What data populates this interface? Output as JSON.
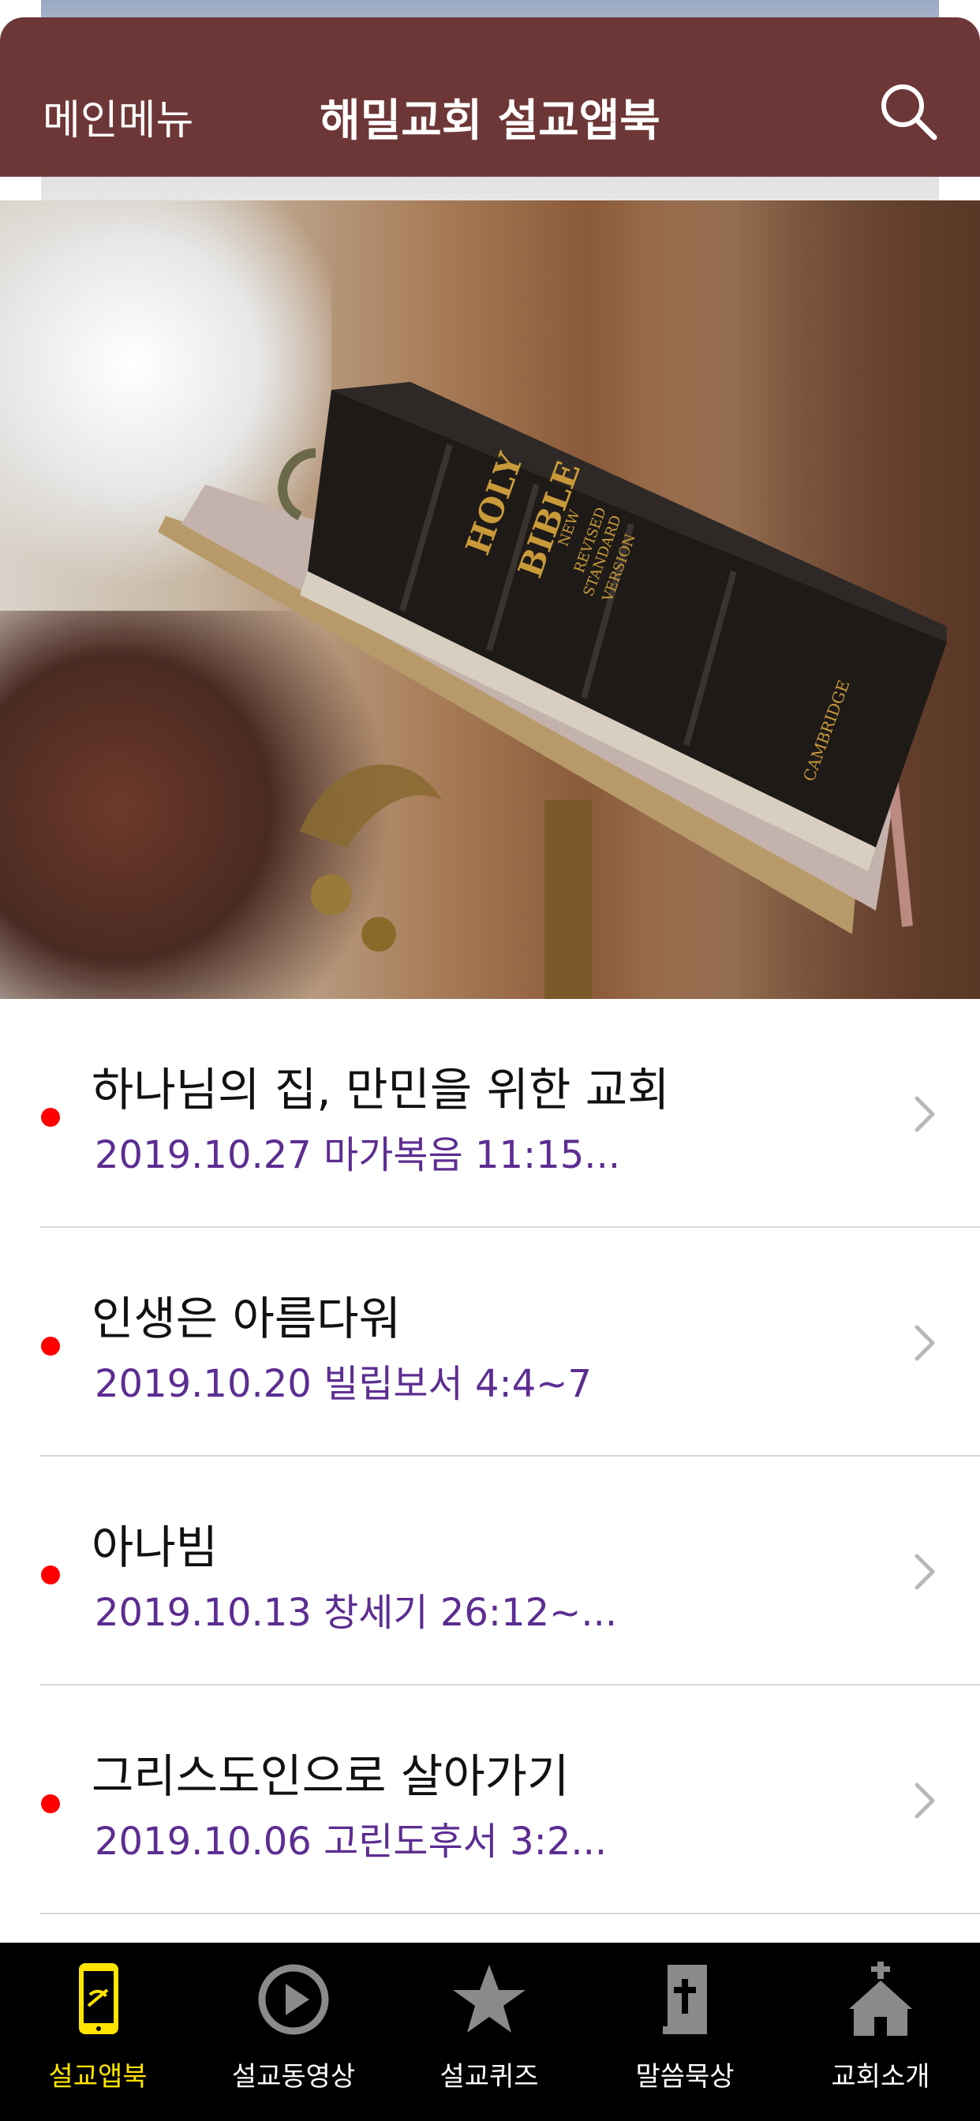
{
  "header": {
    "menu_label": "메인메뉴",
    "title": "해밀교회 설교앱북",
    "search_icon": "search-icon",
    "background": "#6e3737"
  },
  "hero": {
    "image": "bible-on-lectern",
    "book_text": {
      "title_line1": "HOLY",
      "title_line2": "BIBLE",
      "version_line1": "NEW",
      "version_line2": "REVISED",
      "version_line3": "STANDARD",
      "version_line4": "VERSION",
      "publisher": "CAMBRIDGE"
    }
  },
  "sermons": [
    {
      "title": "하나님의 집, 만민을 위한 교회",
      "subtitle": "2019.10.27 마가복음 11:15..."
    },
    {
      "title": "인생은 아름다워",
      "subtitle": "2019.10.20 빌립보서 4:4~7"
    },
    {
      "title": "아나빔",
      "subtitle": "2019.10.13 창세기 26:12~..."
    },
    {
      "title": "그리스도인으로 살아가기",
      "subtitle": "2019.10.06 고린도후서 3:2..."
    }
  ],
  "tabbar": {
    "tabs": [
      {
        "label": "설교앱북",
        "icon": "phone-book-icon",
        "active": true
      },
      {
        "label": "설교동영상",
        "icon": "play-circle-icon",
        "active": false
      },
      {
        "label": "설교퀴즈",
        "icon": "star-icon",
        "active": false
      },
      {
        "label": "말씀묵상",
        "icon": "bible-cross-icon",
        "active": false
      },
      {
        "label": "교회소개",
        "icon": "church-icon",
        "active": false
      }
    ]
  },
  "colors": {
    "accent_active": "#ffe400",
    "subtitle": "#5c2d91",
    "bullet": "#ff0000"
  }
}
